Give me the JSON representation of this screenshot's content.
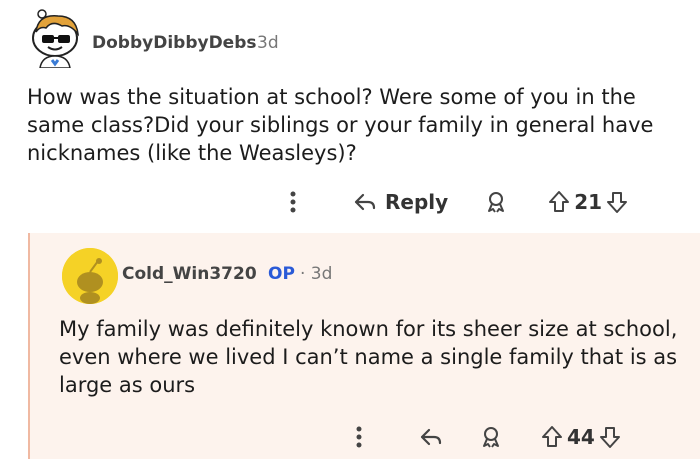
{
  "comment1": {
    "username": "DobbyDibbyDebs",
    "age": "3d",
    "body": "How was the situation at school? Were some of you in the same class?Did your siblings or your family in general have nicknames (like the Weasleys)?",
    "reply_label": "Reply",
    "upvotes": "21",
    "icons": [
      "more-dots-icon",
      "reply-icon",
      "award-icon",
      "upvote-icon",
      "downvote-icon"
    ]
  },
  "comment2": {
    "username": "Cold_Win3720",
    "op_badge": "OP",
    "age": "· 3d",
    "body": "My family was definitely known for its sheer size at school, even where we lived I can’t name a single family that is as large as ours",
    "upvotes": "44",
    "icons": [
      "more-dots-icon",
      "reply-icon",
      "award-icon",
      "upvote-icon",
      "downvote-icon"
    ],
    "thread_line_color": "#f0b9a2",
    "background_color": "#fdf3ed"
  },
  "colors": {
    "op_badge": "#2a5ad7",
    "avatar2_bg": "#f5d226"
  }
}
